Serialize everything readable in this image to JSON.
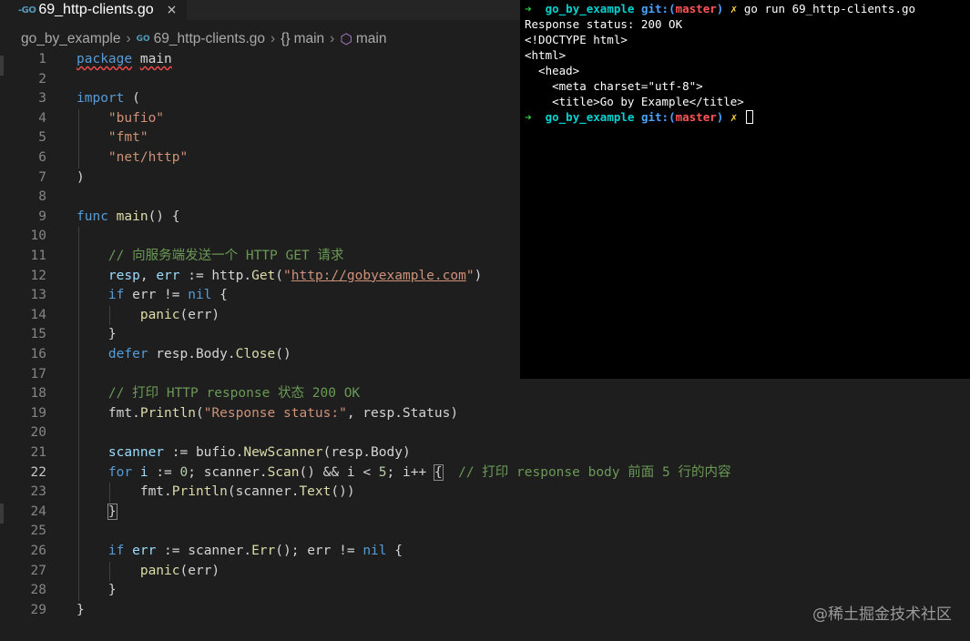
{
  "tab": {
    "icon": "-GO",
    "title": "69_http-clients.go",
    "close": "×"
  },
  "breadcrumb": {
    "folder": "go_by_example",
    "file_icon": "GO",
    "file": "69_http-clients.go",
    "symbol_icon": "{}",
    "symbol": "main",
    "func_icon": "⬡",
    "func": "main"
  },
  "editor": {
    "active_line": 22,
    "line_numbers": [
      "1",
      "2",
      "3",
      "4",
      "5",
      "6",
      "7",
      "8",
      "9",
      "10",
      "11",
      "12",
      "13",
      "14",
      "15",
      "16",
      "17",
      "18",
      "19",
      "20",
      "21",
      "22",
      "23",
      "24",
      "25",
      "26",
      "27",
      "28",
      "29"
    ],
    "code": {
      "l1_kw": "package",
      "l1_name": "main",
      "l3_kw": "import",
      "l3_paren": " (",
      "l4_str": "\"bufio\"",
      "l5_str": "\"fmt\"",
      "l6_str": "\"net/http\"",
      "l7": ")",
      "l9_kw": "func",
      "l9_fn": "main",
      "l9_rest": "() {",
      "l11_cm": "// 向服务端发送一个 HTTP GET 请求",
      "l12_v1": "resp",
      "l12_c": ", ",
      "l12_v2": "err",
      "l12_op": " := http.",
      "l12_fn": "Get",
      "l12_p1": "(",
      "l12_q1": "\"",
      "l12_url": "http://gobyexample.com",
      "l12_q2": "\"",
      "l12_p2": ")",
      "l13_kw": "if",
      "l13_mid": " err != ",
      "l13_nil": "nil",
      "l13_end": " {",
      "l14_fn": "panic",
      "l14_rest": "(err)",
      "l15": "}",
      "l16_kw": "defer",
      "l16_mid": " resp.Body.",
      "l16_fn": "Close",
      "l16_end": "()",
      "l18_cm": "// 打印 HTTP response 状态 200 OK",
      "l19_a": "fmt.",
      "l19_fn": "Println",
      "l19_p": "(",
      "l19_str": "\"Response status:\"",
      "l19_rest": ", resp.Status)",
      "l21_v": "scanner",
      "l21_a": " := bufio.",
      "l21_fn": "NewScanner",
      "l21_rest": "(resp.Body)",
      "l22_kw": "for",
      "l22_v": " i",
      "l22_a": " := ",
      "l22_n0": "0",
      "l22_b": "; scanner.",
      "l22_fn": "Scan",
      "l22_c": "() && i < ",
      "l22_n5": "5",
      "l22_d": "; i++ ",
      "l22_brace": "{",
      "l22_cm": "  // 打印 response body 前面 5 行的内容",
      "l23_a": "fmt.",
      "l23_fn": "Println",
      "l23_b": "(scanner.",
      "l23_fn2": "Text",
      "l23_c": "())",
      "l24_brace": "}",
      "l26_kw": "if",
      "l26_v": " err",
      "l26_a": " := scanner.",
      "l26_fn": "Err",
      "l26_b": "(); err != ",
      "l26_nil": "nil",
      "l26_c": " {",
      "l27_fn": "panic",
      "l27_rest": "(err)",
      "l28": "}",
      "l29": "}"
    }
  },
  "terminal": {
    "prompt_arrow": "➜",
    "prompt_dir": "go_by_example",
    "prompt_git": "git:(",
    "prompt_branch": "master",
    "prompt_git_end": ")",
    "prompt_dirty": "✗",
    "command": "go run 69_http-clients.go",
    "output": [
      "Response status: 200 OK",
      "<!DOCTYPE html>",
      "<html>",
      "  <head>",
      "    <meta charset=\"utf-8\">",
      "    <title>Go by Example</title>"
    ]
  },
  "watermark": "@稀土掘金技术社区"
}
